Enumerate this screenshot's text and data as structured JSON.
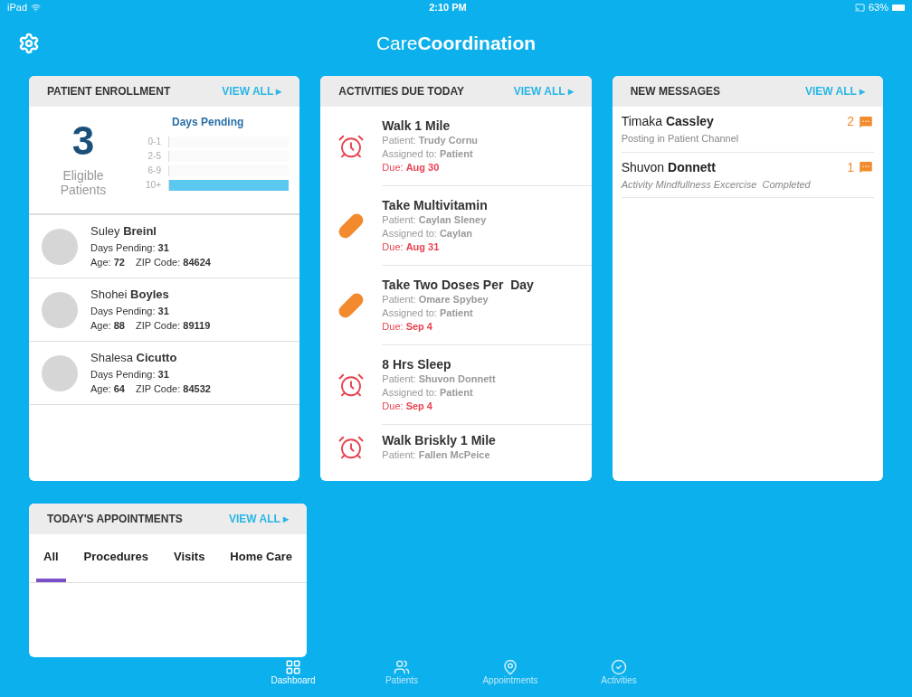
{
  "status_bar": {
    "device": "iPad",
    "time": "2:10 PM",
    "battery": "63%"
  },
  "header": {
    "title": "Care**Coordination**"
  },
  "enrollment": {
    "title": "PATIENT ENROLLMENT",
    "view_all": "VIEW ALL ▸",
    "count": "3",
    "count_label": "Eligible Patients",
    "chart_title": "Days Pending",
    "bars": [
      {
        "label": "0-1",
        "level": 0
      },
      {
        "label": "2-5",
        "level": 0
      },
      {
        "label": "6-9",
        "level": 0
      },
      {
        "label": "10+",
        "level": 1
      }
    ],
    "patients": [
      {
        "name": "Suley **Breinl**",
        "pending": "Days Pending: **31**",
        "age": "Age: **72**",
        "zip": "ZIP Code: **84624**"
      },
      {
        "name": "Shohei **Boyles**",
        "pending": "Days Pending: **31**",
        "age": "Age: **88**",
        "zip": "ZIP Code: **89119**"
      },
      {
        "name": "Shalesa **Cicutto**",
        "pending": "Days Pending: **31**",
        "age": "Age: **64**",
        "zip": "ZIP Code: **84532**"
      }
    ]
  },
  "activities": {
    "title": "ACTIVITIES DUE TODAY",
    "view_all": "VIEW ALL ▸",
    "items": [
      {
        "kind": "alarm",
        "title": "Walk 1 Mile",
        "patient": "Patient: **Trudy Cornu**",
        "assigned": "Assigned to: **Patient**",
        "due": "Due: **Aug 30**"
      },
      {
        "kind": "pill",
        "title": "Take Multivitamin",
        "patient": "Patient: **Caylan Sleney**",
        "assigned": "Assigned to: **Caylan**",
        "due": "Due: **Aug 31**"
      },
      {
        "kind": "pill",
        "title": "Take Two Doses Per  Day",
        "patient": "Patient: **Omare Spybey**",
        "assigned": "Assigned to: **Patient**",
        "due": "Due: **Sep 4**"
      },
      {
        "kind": "alarm",
        "title": "8 Hrs Sleep",
        "patient": "Patient: **Shuvon Donnett**",
        "assigned": "Assigned to: **Patient**",
        "due": "Due: **Sep 4**"
      },
      {
        "kind": "alarm",
        "title": "Walk Briskly 1 Mile",
        "patient": "Patient: **Fallen McPeice**"
      }
    ]
  },
  "messages": {
    "title": "NEW MESSAGES",
    "view_all": "VIEW ALL ▸",
    "items": [
      {
        "name": "Timaka **Cassley**",
        "count": "2",
        "preview": "Posting in Patient Channel",
        "italic": false
      },
      {
        "name": "Shuvon **Donnett**",
        "count": "1",
        "preview": "Activity Mindfullness Excercise  Completed",
        "italic": true
      }
    ]
  },
  "appointments": {
    "title": "TODAY'S APPOINTMENTS",
    "view_all": "VIEW ALL ▸",
    "tabs": [
      {
        "label": "All",
        "selected": true
      },
      {
        "label": "Procedures",
        "selected": false
      },
      {
        "label": "Visits",
        "selected": false
      },
      {
        "label": "Home Care",
        "selected": false
      }
    ]
  },
  "tab_bar": [
    {
      "kind": "grid",
      "label": "Dashboard",
      "selected": true
    },
    {
      "kind": "people",
      "label": "Patients",
      "selected": false
    },
    {
      "kind": "pin",
      "label": "Appointments",
      "selected": false
    },
    {
      "kind": "check",
      "label": "Activities",
      "selected": false
    }
  ]
}
